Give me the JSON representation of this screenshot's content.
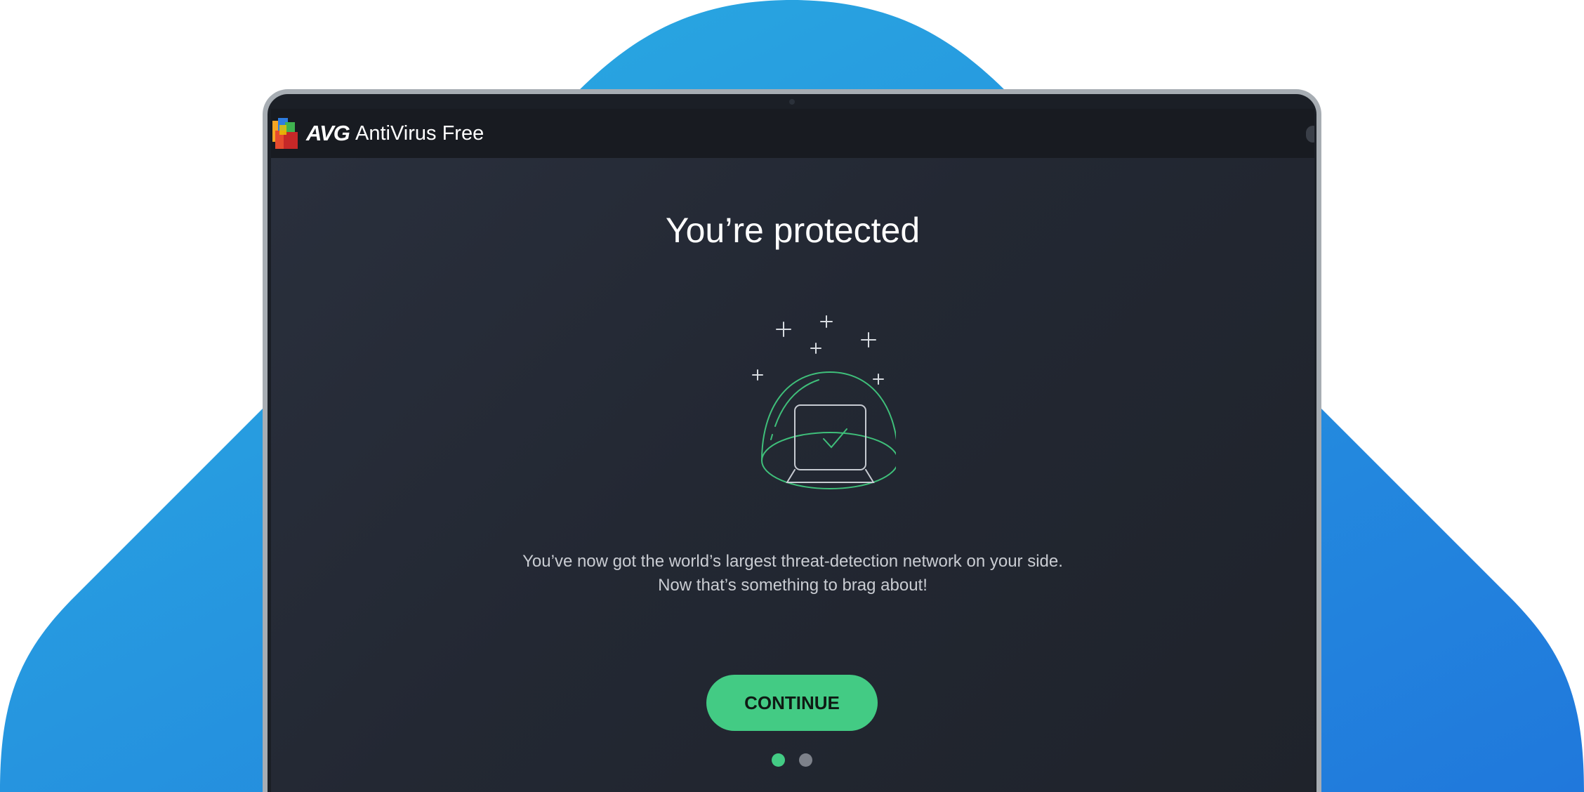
{
  "window": {
    "brand": "AVG",
    "product_name": "AntiVirus Free"
  },
  "main": {
    "heading": "You’re protected",
    "description_line1": "You’ve now got the world’s largest threat-detection network on your side.",
    "description_line2": "Now that’s something to brag about!",
    "continue_label": "CONTINUE"
  },
  "pager": {
    "current_page": 1,
    "total_pages": 2
  },
  "icons": {
    "logo": "avg-logo-icon",
    "illustration": "protected-laptop-dome-illustration",
    "window_control": "window-control-icon"
  },
  "colors": {
    "accent_green": "#43cb84",
    "background_blue_light": "#2bb0e2",
    "background_blue_dark": "#2078dc",
    "screen_background": "#232833",
    "titlebar_background": "#181b21",
    "inactive_dot": "#7d818a"
  }
}
